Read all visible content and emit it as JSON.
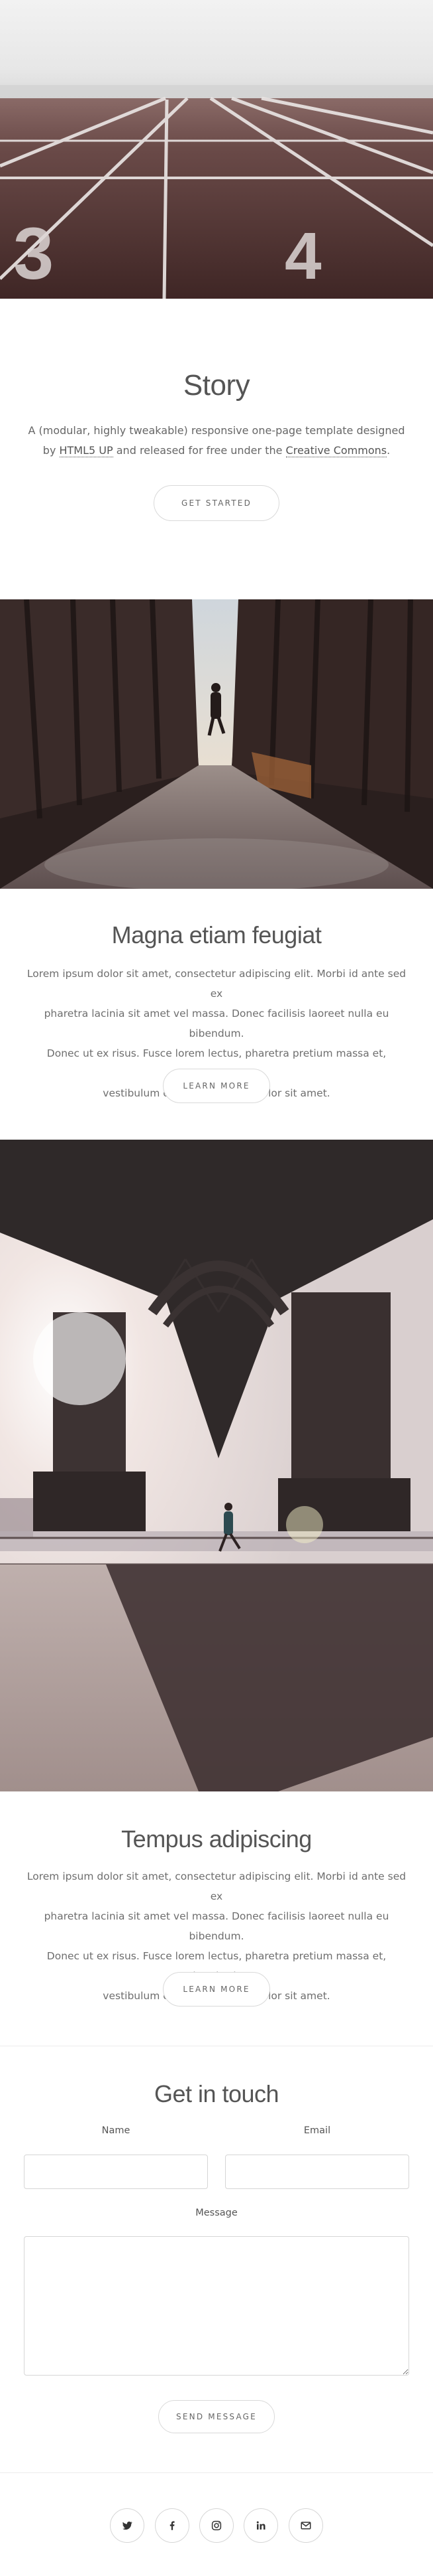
{
  "banner": {
    "lane_numbers": [
      "3",
      "4"
    ]
  },
  "intro": {
    "title": "Story",
    "text_line1": "A (modular, highly tweakable) responsive one-page template designed",
    "text_by": "by",
    "link_html5up": "HTML5 UP",
    "text_middle": "and released for free under the",
    "link_cc": "Creative Commons",
    "text_end": ".",
    "button_label": "Get Started"
  },
  "section1": {
    "title": "Magna etiam feugiat",
    "body_lines": [
      "Lorem ipsum dolor sit amet, consectetur adipiscing elit. Morbi id ante sed ex",
      "pharetra lacinia sit amet vel massa. Donec facilisis laoreet nulla eu bibendum.",
      "Donec ut ex risus. Fusce lorem lectus, pharetra pretium massa et, hendrerit",
      "vestibulum odio lorem ipsum dolor sit amet."
    ],
    "button_label": "Learn More"
  },
  "section2": {
    "title": "Tempus adipiscing",
    "body_lines": [
      "Lorem ipsum dolor sit amet, consectetur adipiscing elit. Morbi id ante sed ex",
      "pharetra lacinia sit amet vel massa. Donec facilisis laoreet nulla eu bibendum.",
      "Donec ut ex risus. Fusce lorem lectus, pharetra pretium massa et, hendrerit",
      "vestibulum odio lorem ipsum dolor sit amet."
    ],
    "button_label": "Learn More"
  },
  "contact": {
    "title": "Get in touch",
    "name_label": "Name",
    "email_label": "Email",
    "message_label": "Message",
    "name_value": "",
    "email_value": "",
    "message_value": "",
    "submit_label": "Send Message"
  },
  "footer": {
    "social_icons": [
      "twitter-icon",
      "facebook-icon",
      "instagram-icon",
      "linkedin-icon",
      "email-icon"
    ]
  }
}
